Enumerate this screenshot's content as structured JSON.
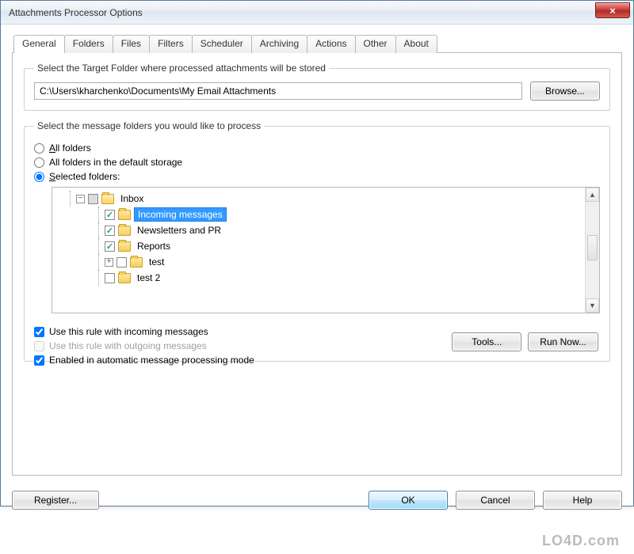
{
  "window": {
    "title": "Attachments Processor Options",
    "close_glyph": "×"
  },
  "tabs": [
    "General",
    "Folders",
    "Files",
    "Filters",
    "Scheduler",
    "Archiving",
    "Actions",
    "Other",
    "About"
  ],
  "target_group": {
    "legend": "Select the Target Folder where processed attachments will be stored",
    "path": "C:\\Users\\kharchenko\\Documents\\My Email Attachments",
    "browse_label": "Browse..."
  },
  "folder_group": {
    "legend": "Select the message folders you would like to process",
    "radios": {
      "all": "All folders",
      "all_u": "A",
      "default_storage": "All folders in the default storage",
      "selected": "Selected folders:",
      "selected_u": "S"
    },
    "tree": {
      "inbox": "Inbox",
      "incoming": "Incoming messages",
      "newsletters": "Newsletters and PR",
      "reports": "Reports",
      "test": "test",
      "test2": "test 2"
    }
  },
  "checks": {
    "incoming": "Use this rule with incoming messages",
    "outgoing": "Use this rule with outgoing messages",
    "auto": "Enabled in automatic message processing mode"
  },
  "buttons": {
    "tools": "Tools...",
    "run_now": "Run Now...",
    "register": "Register...",
    "ok": "OK",
    "cancel": "Cancel",
    "help": "Help"
  },
  "watermark": "LO4D.com"
}
